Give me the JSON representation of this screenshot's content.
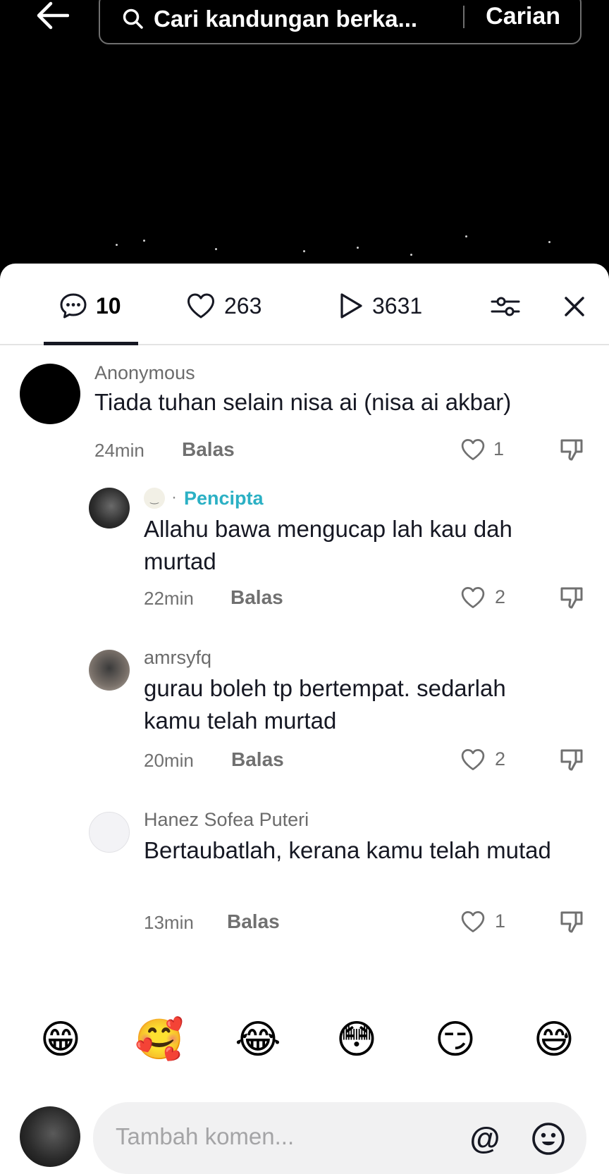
{
  "search": {
    "placeholder": "Cari kandungan berka...",
    "submit_label": "Carian"
  },
  "tabs": {
    "comments_count": "10",
    "likes_count": "263",
    "plays_count": "3631"
  },
  "comments": [
    {
      "username": "Anonymous",
      "text": "Tiada tuhan selain nisa ai (nisa ai akbar)",
      "time": "24min",
      "reply_label": "Balas",
      "likes": "1"
    },
    {
      "username": "Pencipta",
      "text": "Allahu bawa mengucap lah kau dah murtad",
      "time": "22min",
      "reply_label": "Balas",
      "likes": "2"
    },
    {
      "username": "amrsyfq",
      "text": "gurau boleh tp bertempat. sedarlah kamu telah murtad",
      "time": "20min",
      "reply_label": "Balas",
      "likes": "2"
    },
    {
      "username": "Hanez Sofea Puteri",
      "text": "Bertaubatlah, kerana kamu telah mutad",
      "time": "13min",
      "reply_label": "Balas",
      "likes": "1"
    }
  ],
  "quick_emojis": [
    "😁",
    "🥰",
    "😂",
    "😳",
    "😏",
    "😅"
  ],
  "composer": {
    "placeholder": "Tambah komen...",
    "mention_label": "@"
  },
  "colors": {
    "creator_label": "#2bb0c4",
    "background_top": "#000000",
    "sheet": "#ffffff"
  }
}
